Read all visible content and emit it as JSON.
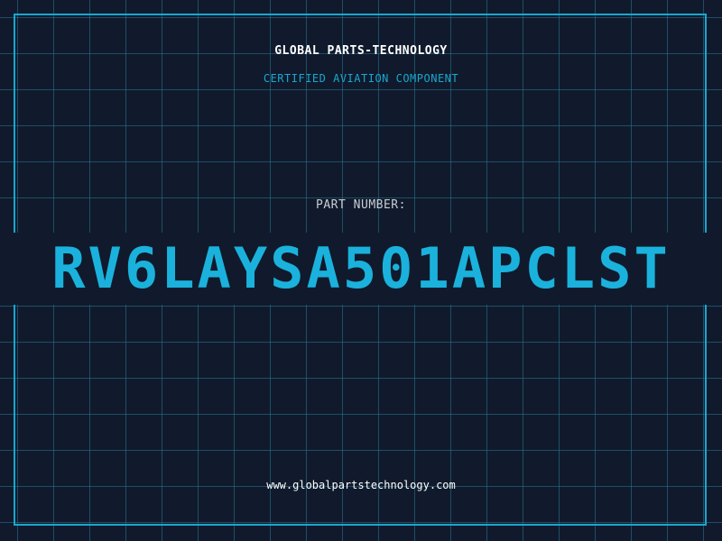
{
  "header": {
    "company": "GLOBAL PARTS-TECHNOLOGY",
    "subtitle": "CERTIFIED AVIATION COMPONENT"
  },
  "part": {
    "label": "PART NUMBER:",
    "number": "RV6LAYSA501APCLST"
  },
  "footer": {
    "website": "www.globalpartstechnology.com"
  },
  "colors": {
    "background": "#101a2c",
    "accent": "#1ab2dc",
    "grid": "#28788f",
    "text": "#ffffff"
  }
}
